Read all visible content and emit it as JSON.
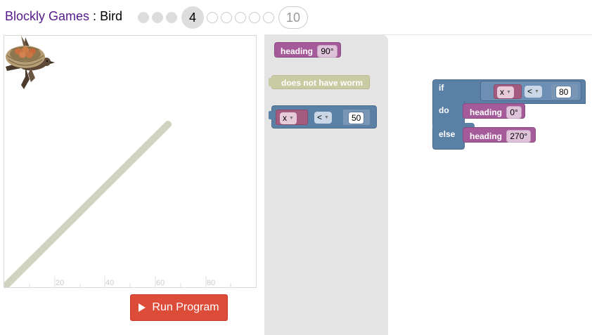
{
  "header": {
    "app_name": "Blockly Games",
    "separator": " : ",
    "game_name": "Bird",
    "current_level": "4",
    "last_level": "10"
  },
  "stage": {
    "ticks": [
      "20",
      "40",
      "60",
      "80"
    ]
  },
  "run_button": {
    "label": "Run Program"
  },
  "toolbox": {
    "heading_label": "heading",
    "heading_value": "90°",
    "worm_label": "does not have worm",
    "compare_var": "x",
    "compare_op": "<",
    "compare_value": "50"
  },
  "workspace": {
    "if_label": "if",
    "do_label": "do",
    "else_label": "else",
    "cond_var": "x",
    "cond_op": "<",
    "cond_value": "80",
    "do_block_label": "heading",
    "do_block_value": "0°",
    "else_block_label": "heading",
    "else_block_value": "270°"
  },
  "colors": {
    "motion_block": "#a55b99",
    "logic_block": "#5b80a5",
    "sensor_block": "#c9cba3",
    "variable_block": "#a55b80",
    "run_button": "#dd4b39",
    "path_wall": "#d0d3bf"
  }
}
